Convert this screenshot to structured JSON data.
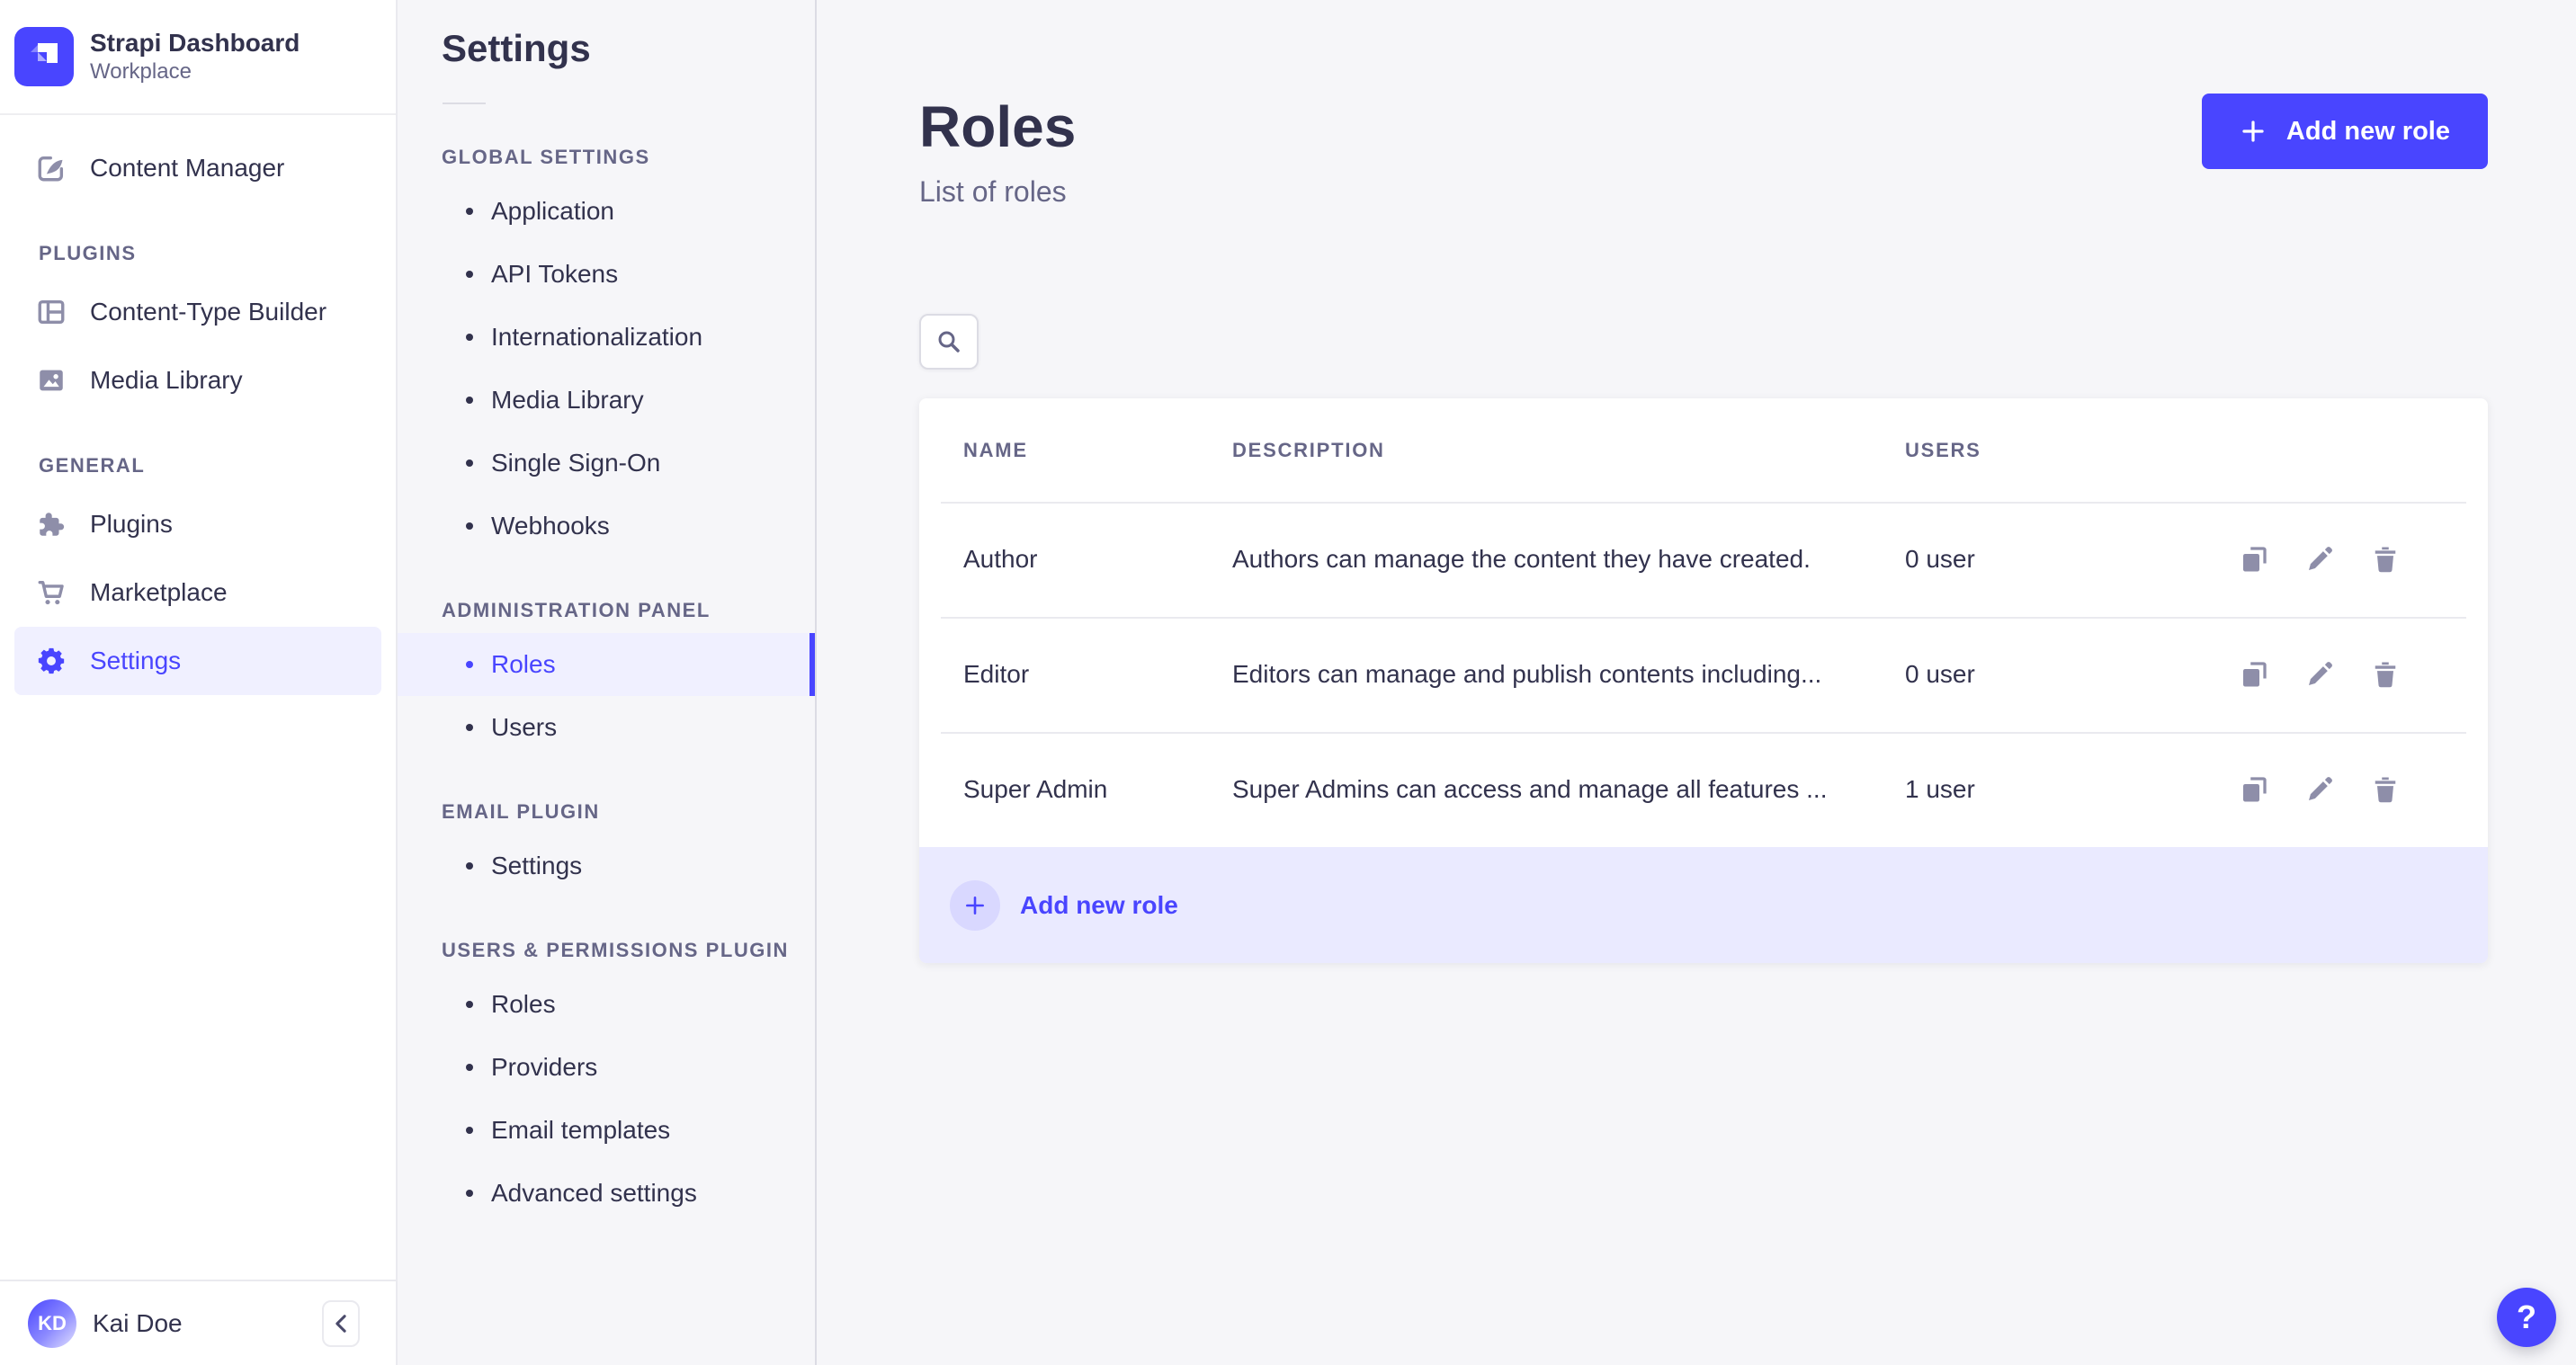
{
  "app": {
    "name": "Strapi Dashboard",
    "workspace": "Workplace"
  },
  "colors": {
    "primary": "#4945ff",
    "primary_light_bg": "#f0f0ff",
    "primary_badge_bg": "#d9d8ff",
    "footer_bg": "#eaeaff",
    "text_dark": "#32324d",
    "text_grey": "#666687",
    "icon_grey": "#8e8ea9",
    "border": "#eaeaef",
    "page_bg": "#f6f6f9"
  },
  "main_nav": {
    "content_manager": "Content Manager",
    "sections": [
      {
        "label": "PLUGINS",
        "items": [
          {
            "label": "Content-Type Builder",
            "icon": "content-type-builder-icon"
          },
          {
            "label": "Media Library",
            "icon": "media-library-icon"
          }
        ]
      },
      {
        "label": "GENERAL",
        "items": [
          {
            "label": "Plugins",
            "icon": "plugins-icon"
          },
          {
            "label": "Marketplace",
            "icon": "marketplace-icon"
          },
          {
            "label": "Settings",
            "icon": "settings-gear-icon",
            "selected": true
          }
        ]
      }
    ],
    "user": {
      "initials": "KD",
      "name": "Kai Doe"
    }
  },
  "subnav": {
    "title": "Settings",
    "sections": [
      {
        "label": "GLOBAL SETTINGS",
        "items": [
          "Application",
          "API Tokens",
          "Internationalization",
          "Media Library",
          "Single Sign-On",
          "Webhooks"
        ]
      },
      {
        "label": "ADMINISTRATION PANEL",
        "items": [
          "Roles",
          "Users"
        ],
        "selected_item": "Roles"
      },
      {
        "label": "EMAIL PLUGIN",
        "items": [
          "Settings"
        ]
      },
      {
        "label": "USERS & PERMISSIONS PLUGIN",
        "items": [
          "Roles",
          "Providers",
          "Email templates",
          "Advanced settings"
        ]
      }
    ]
  },
  "page": {
    "title": "Roles",
    "subtitle": "List of roles",
    "add_button_label": "Add new role",
    "table": {
      "headers": [
        "NAME",
        "DESCRIPTION",
        "USERS"
      ],
      "rows": [
        {
          "name": "Author",
          "description": "Authors can manage the content they have created.",
          "users": "0 user"
        },
        {
          "name": "Editor",
          "description": "Editors can manage and publish contents including...",
          "users": "0 user"
        },
        {
          "name": "Super Admin",
          "description": "Super Admins can access and manage all features ...",
          "users": "1 user"
        }
      ],
      "footer_add_label": "Add new role"
    },
    "help_label": "?"
  }
}
